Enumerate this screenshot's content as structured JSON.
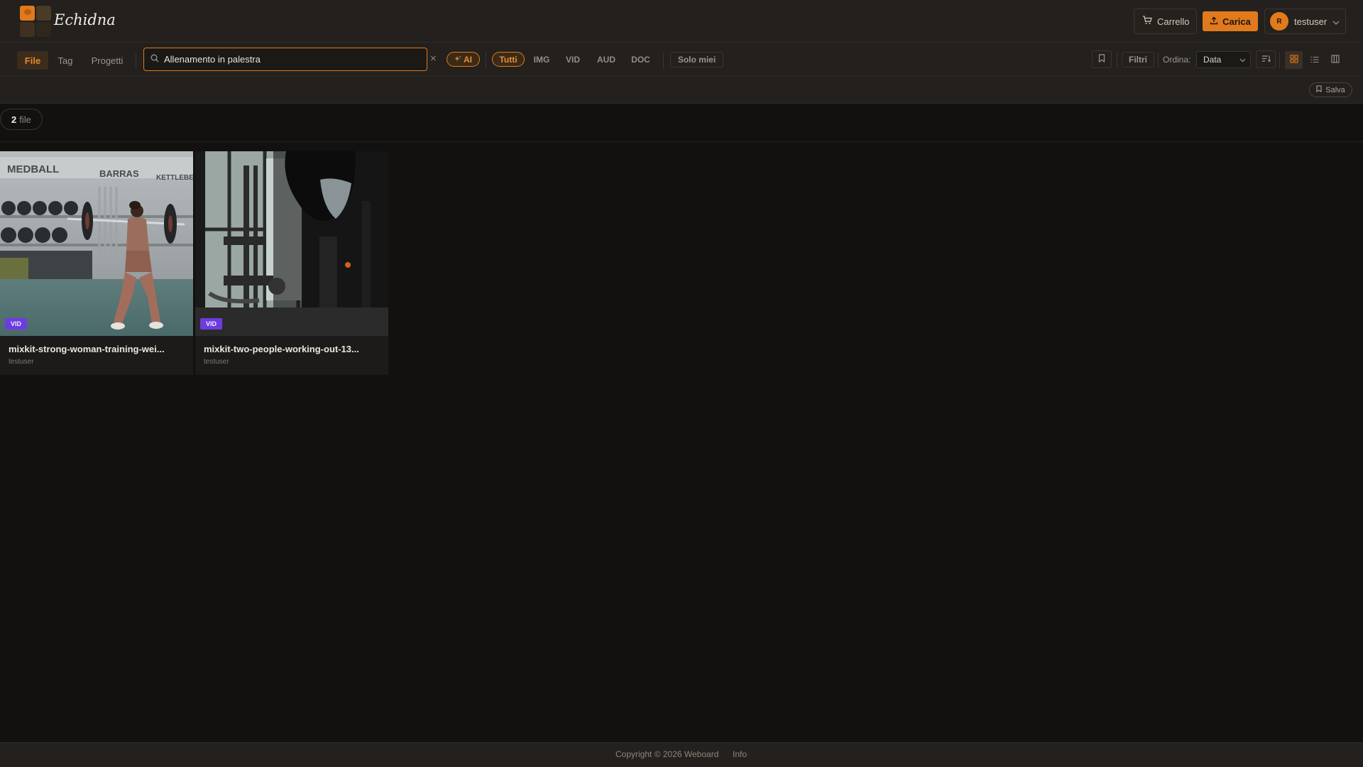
{
  "app": {
    "name": "Echidna"
  },
  "header": {
    "cart_label": "Carrello",
    "upload_label": "Carica",
    "user": {
      "initial": "R",
      "name": "testuser"
    }
  },
  "nav": {
    "tabs": [
      {
        "label": "File",
        "active": true
      },
      {
        "label": "Tag",
        "active": false
      },
      {
        "label": "Progetti",
        "active": false
      }
    ]
  },
  "search": {
    "value": "Allenamento in palestra",
    "placeholder": ""
  },
  "filters": {
    "ai_label": "AI",
    "types": [
      {
        "label": "Tutti",
        "active": true
      },
      {
        "label": "IMG"
      },
      {
        "label": "VID"
      },
      {
        "label": "AUD"
      },
      {
        "label": "DOC"
      }
    ],
    "only_mine_label": "Solo miei",
    "filters_label": "Filtri",
    "sort_label": "Ordina:",
    "sort_value": "Data"
  },
  "subbar": {
    "save_label": "Salva"
  },
  "results": {
    "count": "2",
    "unit": "file"
  },
  "files": [
    {
      "type": "VID",
      "title": "mixkit-strong-woman-training-wei...",
      "owner": "testuser"
    },
    {
      "type": "VID",
      "title": "mixkit-two-people-working-out-13...",
      "owner": "testuser"
    }
  ],
  "footer": {
    "copyright": "Copyright © 2026 Weboard",
    "info_label": "Info"
  },
  "colors": {
    "accent": "#e07a1c",
    "video_badge": "#6d3ce0",
    "background": "#121110",
    "panel": "#23201d"
  }
}
